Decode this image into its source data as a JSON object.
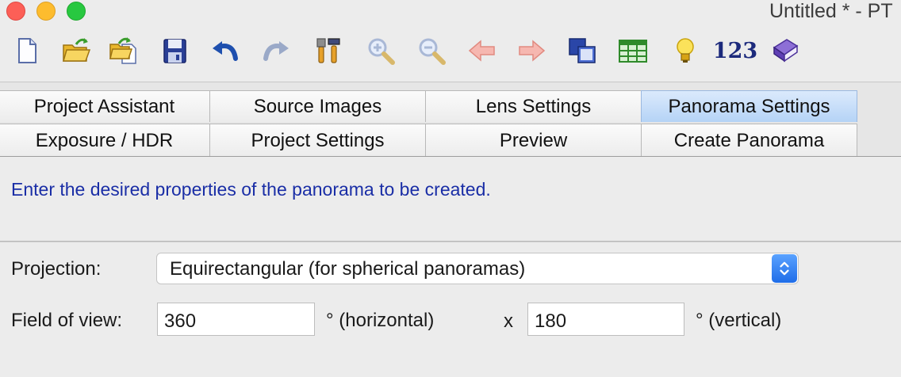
{
  "window": {
    "title": "Untitled * - PT"
  },
  "toolbar": {
    "buttons": [
      {
        "name": "new-project",
        "icon": "new-document-icon"
      },
      {
        "name": "open-project",
        "icon": "open-folder-icon"
      },
      {
        "name": "open-recent",
        "icon": "open-recent-icon"
      },
      {
        "name": "save-project",
        "icon": "floppy-disk-icon"
      },
      {
        "name": "undo",
        "icon": "undo-arrow-icon"
      },
      {
        "name": "redo",
        "icon": "redo-arrow-icon"
      },
      {
        "name": "settings-tools",
        "icon": "tools-icon"
      },
      {
        "name": "zoom-in",
        "icon": "zoom-in-icon"
      },
      {
        "name": "zoom-out",
        "icon": "zoom-out-icon"
      },
      {
        "name": "previous",
        "icon": "left-arrow-icon"
      },
      {
        "name": "next",
        "icon": "right-arrow-icon"
      },
      {
        "name": "images-list",
        "icon": "overlapping-windows-icon"
      },
      {
        "name": "table",
        "icon": "spreadsheet-icon"
      },
      {
        "name": "tips",
        "icon": "lightbulb-icon"
      },
      {
        "name": "numbers",
        "icon": "numbers-icon"
      },
      {
        "name": "help",
        "icon": "help-book-icon"
      }
    ],
    "numbers_label": "123"
  },
  "tabs": {
    "row1": [
      {
        "label": "Project Assistant",
        "active": false
      },
      {
        "label": "Source Images",
        "active": false
      },
      {
        "label": "Lens Settings",
        "active": false
      },
      {
        "label": "Panorama Settings",
        "active": true
      }
    ],
    "row2": [
      {
        "label": "Exposure / HDR",
        "active": false
      },
      {
        "label": "Project Settings",
        "active": false
      },
      {
        "label": "Preview",
        "active": false
      },
      {
        "label": "Create Panorama",
        "active": false
      }
    ]
  },
  "panel": {
    "description": "Enter the desired properties of the panorama to be created.",
    "projection": {
      "label": "Projection:",
      "value": "Equirectangular (for spherical panoramas)"
    },
    "fov": {
      "label": "Field of view:",
      "horizontal_value": "360",
      "horizontal_unit": "° (horizontal)",
      "separator": "x",
      "vertical_value": "180",
      "vertical_unit": "° (vertical)"
    }
  },
  "colors": {
    "accent": "#1a2ea6",
    "active_tab": "#b5d3f6",
    "stepper": "#2f7bf0"
  }
}
